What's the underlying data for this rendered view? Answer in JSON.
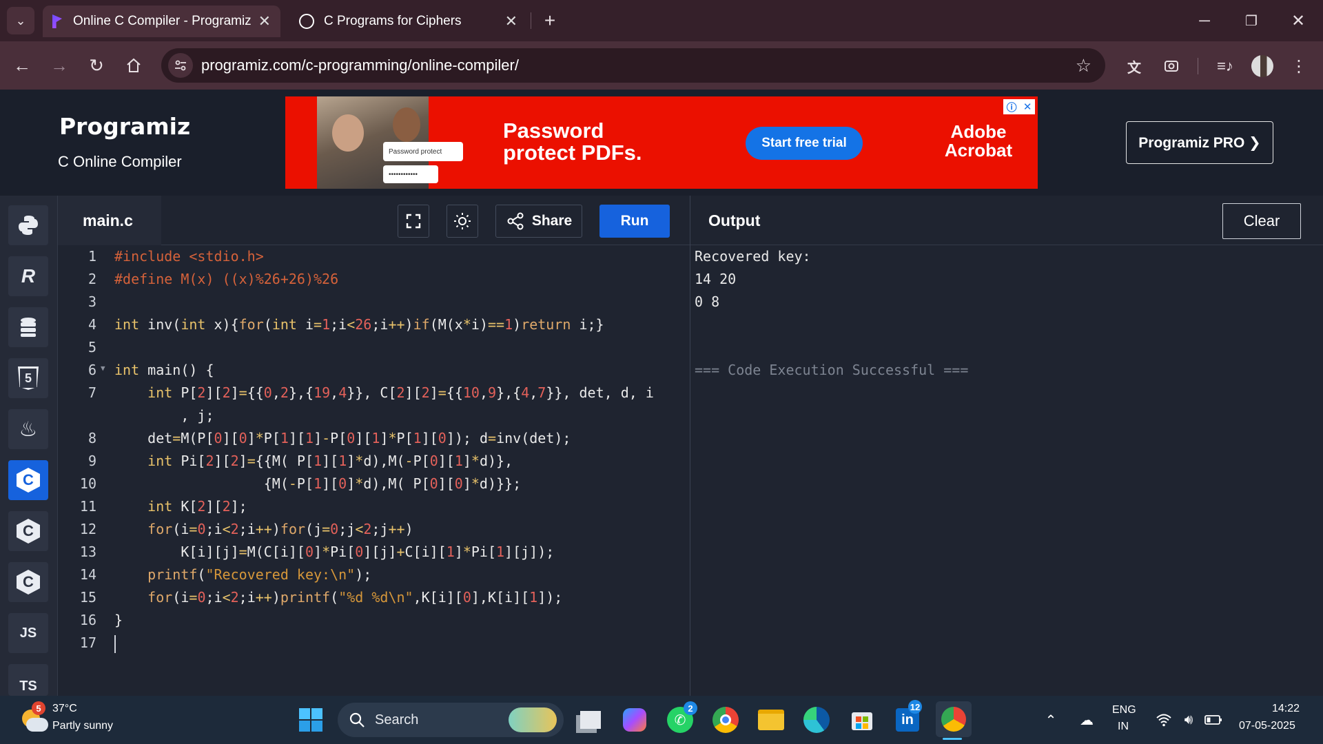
{
  "browser": {
    "tabs": [
      {
        "title": "Online C Compiler - Programiz",
        "active": true
      },
      {
        "title": "C Programs for Ciphers",
        "active": false
      }
    ],
    "url": "programiz.com/c-programming/online-compiler/"
  },
  "site": {
    "logo_text": "Programiz",
    "subtitle": "C Online Compiler",
    "pro_button": "Programiz PRO ❯",
    "ad": {
      "headline": "Password protect PDFs.",
      "cta": "Start free trial",
      "brand": "Adobe Acrobat",
      "field_label": "Password protect",
      "field_value": "••••••••••••"
    }
  },
  "sidebar": {
    "items": [
      {
        "icon": "python-icon",
        "label": ""
      },
      {
        "icon": "r-icon",
        "label": "R"
      },
      {
        "icon": "sql-icon",
        "label": ""
      },
      {
        "icon": "html-icon",
        "label": "5"
      },
      {
        "icon": "java-icon",
        "label": ""
      },
      {
        "icon": "c-icon",
        "label": "C",
        "active": true
      },
      {
        "icon": "cpp-icon",
        "label": "C"
      },
      {
        "icon": "csharp-icon",
        "label": "C"
      },
      {
        "icon": "js-icon",
        "label": "JS"
      },
      {
        "icon": "ts-icon",
        "label": "TS"
      }
    ]
  },
  "editor": {
    "filename": "main.c",
    "share_label": "Share",
    "run_label": "Run",
    "line_numbers": [
      "1",
      "2",
      "3",
      "4",
      "5",
      "6",
      "7",
      "",
      "8",
      "9",
      "10",
      "11",
      "12",
      "13",
      "14",
      "15",
      "16",
      "17"
    ]
  },
  "output": {
    "title": "Output",
    "clear_label": "Clear",
    "lines": [
      "Recovered key:",
      "14 20",
      "0 8",
      "",
      "",
      "=== Code Execution Successful ==="
    ]
  },
  "taskbar": {
    "weather_temp": "37°C",
    "weather_desc": "Partly sunny",
    "weather_badge": "5",
    "search_label": "Search",
    "whatsapp_badge": "2",
    "linkedin_badge": "12",
    "lang_top": "ENG",
    "lang_bottom": "IN",
    "time": "14:22",
    "date": "07-05-2025"
  },
  "colors": {
    "accent": "#1662dd",
    "ad_red": "#eb1000",
    "editor_bg": "#1f2430",
    "preprocessor": "#d6623a",
    "keyword": "#e8c26a",
    "number": "#e4615a"
  }
}
